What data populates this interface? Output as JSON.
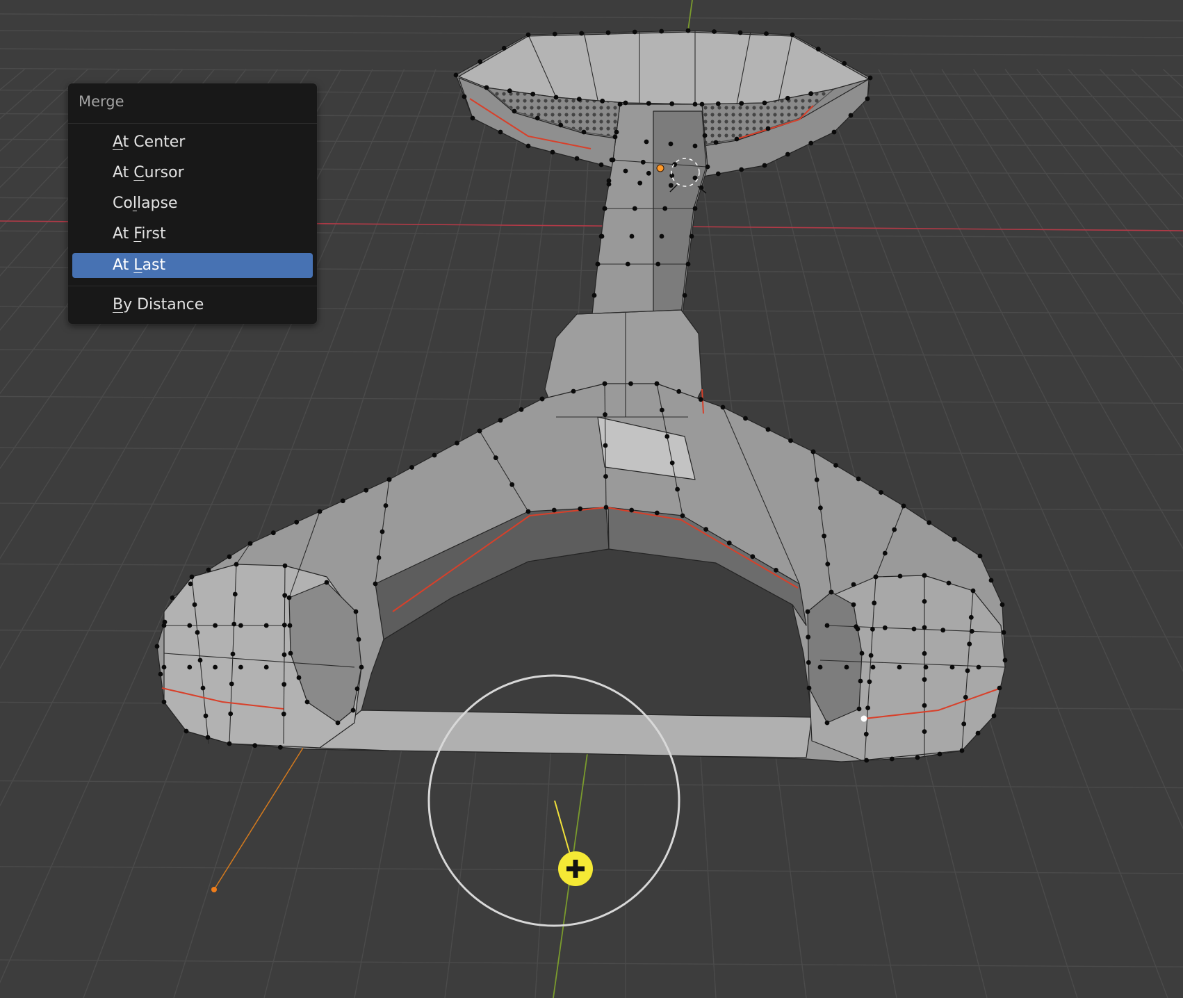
{
  "merge_menu": {
    "title": "Merge",
    "items": [
      {
        "pre": "",
        "key": "A",
        "post": "t Center",
        "active": false
      },
      {
        "pre": "At ",
        "key": "C",
        "post": "ursor",
        "active": false
      },
      {
        "pre": "Co",
        "key": "l",
        "post": "lapse",
        "active": false
      },
      {
        "pre": "At ",
        "key": "F",
        "post": "irst",
        "active": false
      },
      {
        "pre": "At ",
        "key": "L",
        "post": "ast",
        "active": true
      },
      {
        "pre": "",
        "key": "B",
        "post": "y Distance",
        "active": false
      }
    ]
  },
  "viewport": {
    "background_color": "#3d3d3d",
    "grid_color": "#4a4a4a",
    "x_axis_color": "#b83545",
    "y_axis_color": "#7a9a2e",
    "mesh_face_color": "#979797",
    "mesh_edge_color": "#262626",
    "vertex_color": "#000000",
    "seam_color": "#d8402a",
    "active_vertex_color": "#ffffff",
    "selected_vertex_color": "#ff9a2a",
    "cursor_icon": "yellow-plus-cursor-icon",
    "cursor_color": "#f5e935"
  }
}
